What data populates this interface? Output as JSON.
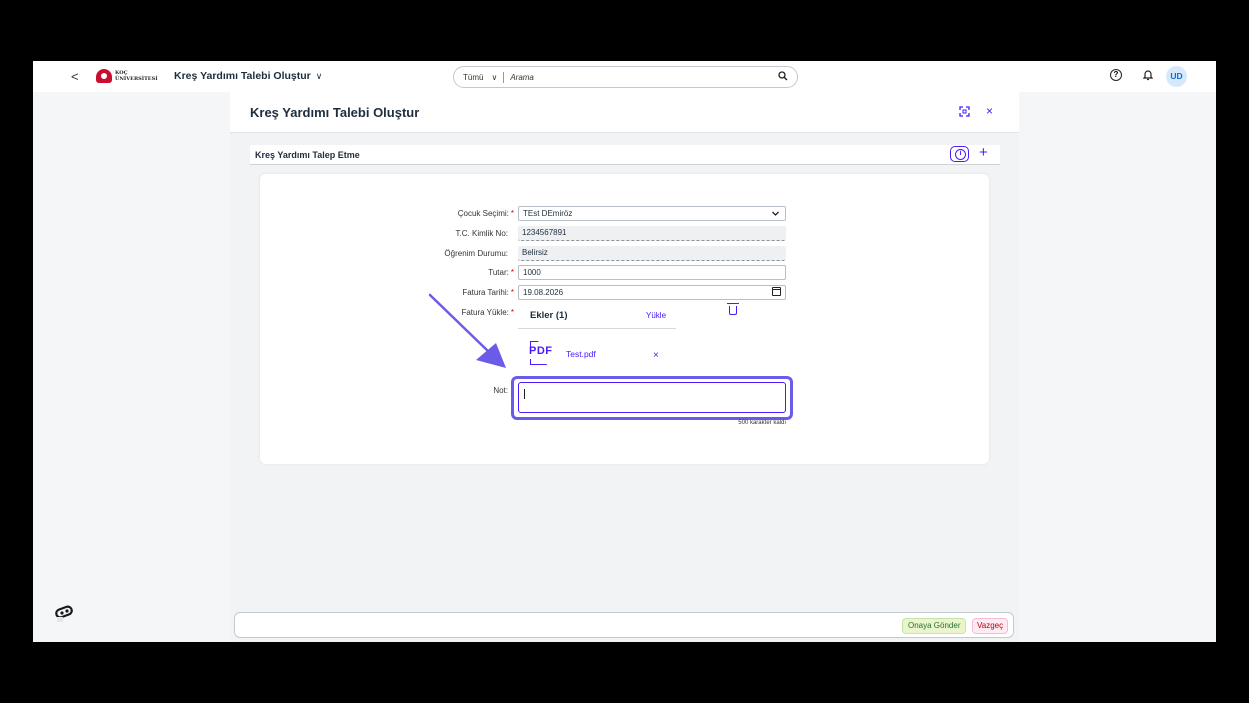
{
  "shell": {
    "back": "<",
    "logo_line1": "KOÇ",
    "logo_line2": "ÜNİVERSİTESİ",
    "app_title": "Kreş Yardımı Talebi Oluştur",
    "title_chevron": "∨",
    "search_scope": "Tümü",
    "search_scope_chevron": "∨",
    "search_placeholder": "Arama",
    "avatar_initials": "UD"
  },
  "dialog": {
    "title": "Kreş Yardımı Talebi Oluştur",
    "close": "×"
  },
  "section": {
    "title": "Kreş Yardımı Talep Etme",
    "add": "+"
  },
  "form": {
    "child_label": "Çocuk Seçimi:",
    "child_value": "TEst DEmiröz",
    "tc_label": "T.C. Kimlik No:",
    "tc_value": "1234567891",
    "edu_label": "Öğrenim Durumu:",
    "edu_value": "Belirsiz",
    "amount_label": "Tutar:",
    "amount_value": "1000",
    "invoice_date_label": "Fatura Tarihi:",
    "invoice_date_value": "19.08.2026",
    "invoice_upload_label": "Fatura Yükle:",
    "attachments_title": "Ekler (1)",
    "upload_link": "Yükle",
    "file_type": "PDF",
    "file_name": "Test.pdf",
    "file_remove": "×",
    "note_label": "Not:",
    "note_value": "",
    "chars_left": "500 karakter kaldı",
    "required_mark": "*"
  },
  "footer": {
    "approve": "Onaya Gönder",
    "cancel": "Vazgeç"
  },
  "colors": {
    "accent": "#4b1bff",
    "annotation": "#6b5ce7",
    "approve_bg": "#ebf5cb",
    "cancel_bg": "#ffeaf4"
  }
}
